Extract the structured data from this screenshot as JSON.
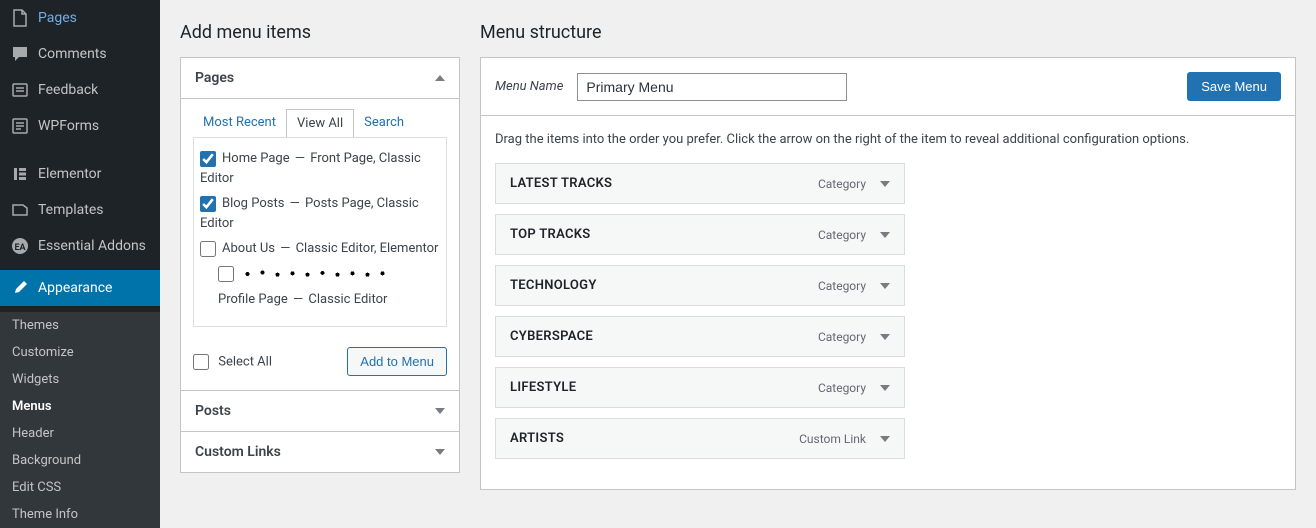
{
  "sidebar": {
    "items": [
      {
        "label": "Pages",
        "icon": "page"
      },
      {
        "label": "Comments",
        "icon": "comment"
      },
      {
        "label": "Feedback",
        "icon": "feedback"
      },
      {
        "label": "WPForms",
        "icon": "wpforms"
      },
      {
        "label": "Elementor",
        "icon": "elementor"
      },
      {
        "label": "Templates",
        "icon": "templates"
      },
      {
        "label": "Essential Addons",
        "icon": "ea"
      },
      {
        "label": "Appearance",
        "icon": "brush"
      }
    ],
    "submenu": [
      "Themes",
      "Customize",
      "Widgets",
      "Menus",
      "Header",
      "Background",
      "Edit CSS",
      "Theme Info"
    ],
    "submenu_current": "Menus"
  },
  "left": {
    "heading": "Add menu items",
    "accordions": {
      "pages": {
        "title": "Pages",
        "tabs": [
          "Most Recent",
          "View All",
          "Search"
        ],
        "active_tab": "View All",
        "items": [
          {
            "checked": true,
            "label": "Home Page",
            "meta": "Front Page, Classic Editor",
            "indent": false
          },
          {
            "checked": true,
            "label": "Blog Posts",
            "meta": "Posts Page, Classic Editor",
            "indent": false
          },
          {
            "checked": false,
            "label": "About Us",
            "meta": "Classic Editor, Elementor",
            "indent": false
          },
          {
            "checked": false,
            "label": "",
            "meta": "",
            "indent": true,
            "redacted": true
          },
          {
            "checked": false,
            "label": "Profile Page",
            "meta": "Classic Editor",
            "indent": true,
            "nocheck": true
          }
        ],
        "select_all": "Select All",
        "add_button": "Add to Menu"
      },
      "posts": {
        "title": "Posts"
      },
      "custom_links": {
        "title": "Custom Links"
      }
    }
  },
  "right": {
    "heading": "Menu structure",
    "menu_name_label": "Menu Name",
    "menu_name_value": "Primary Menu",
    "save_button": "Save Menu",
    "instructions": "Drag the items into the order you prefer. Click the arrow on the right of the item to reveal additional configuration options.",
    "menu_items": [
      {
        "title": "LATEST TRACKS",
        "type": "Category",
        "indent": false
      },
      {
        "title": "TOP TRACKS",
        "type": "Category",
        "indent": false
      },
      {
        "title": "TECHNOLOGY",
        "type": "Category",
        "indent": false
      },
      {
        "title": "CYBERSPACE",
        "type": "Category",
        "indent": false
      },
      {
        "title": "LIFESTYLE",
        "type": "Category",
        "indent": false
      },
      {
        "title": "ARTISTS",
        "type": "Custom Link",
        "indent": false
      }
    ]
  }
}
